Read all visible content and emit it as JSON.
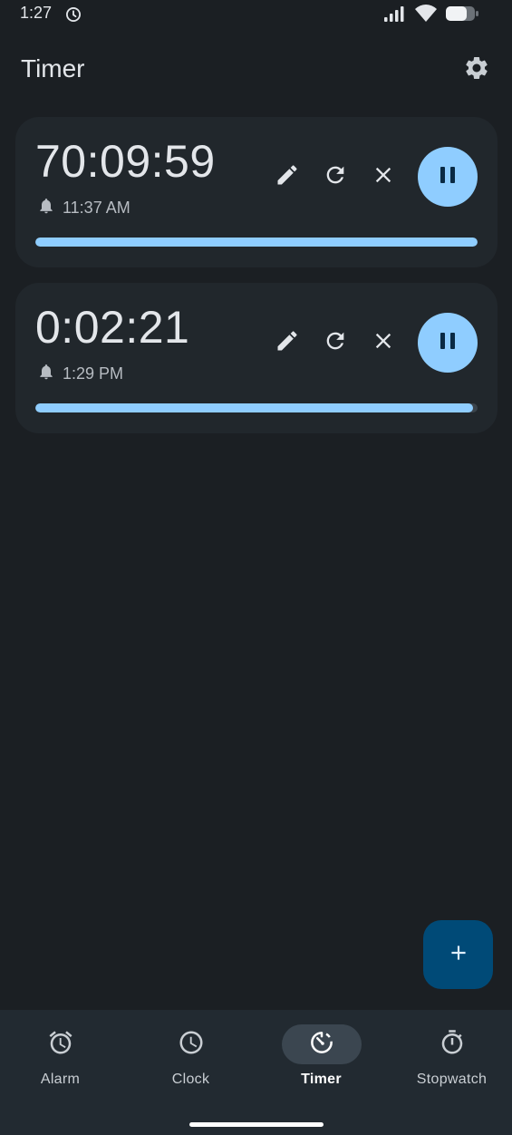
{
  "status_bar": {
    "time": "1:27"
  },
  "app_bar": {
    "title": "Timer"
  },
  "timers": [
    {
      "remaining": "70:09:59",
      "alarm_time": "11:37 AM",
      "progress": 1.0
    },
    {
      "remaining": "0:02:21",
      "alarm_time": "1:29 PM",
      "progress": 0.99
    }
  ],
  "bottom_nav": {
    "items": [
      {
        "label": "Alarm",
        "icon": "alarm-icon"
      },
      {
        "label": "Clock",
        "icon": "clock-icon"
      },
      {
        "label": "Timer",
        "icon": "timer-icon",
        "active": true
      },
      {
        "label": "Stopwatch",
        "icon": "stopwatch-icon"
      }
    ]
  },
  "colors": {
    "background": "#1b1f23",
    "card": "#21272c",
    "accent": "#8fcdff",
    "fab": "#004a77"
  }
}
